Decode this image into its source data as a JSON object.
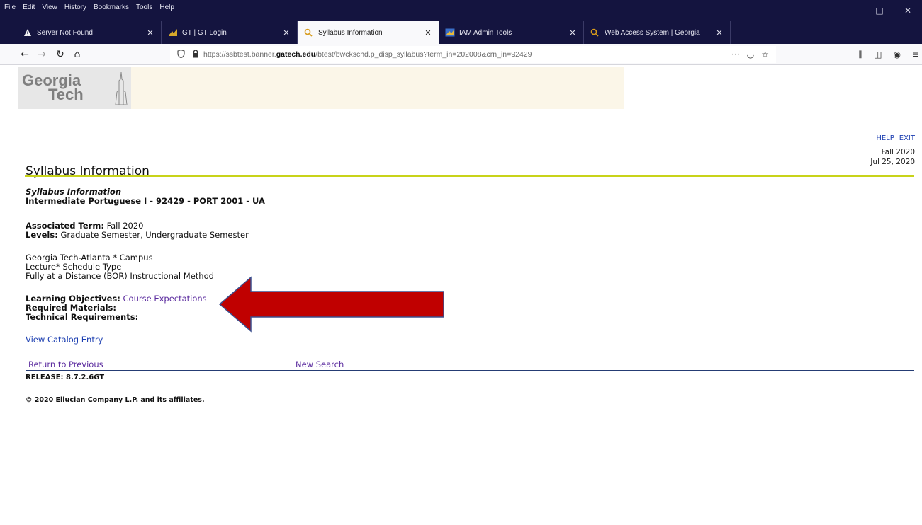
{
  "browser": {
    "menu": [
      "File",
      "Edit",
      "View",
      "History",
      "Bookmarks",
      "Tools",
      "Help"
    ],
    "window_controls": {
      "minimize": "–",
      "maximize": "□",
      "close": "✕"
    },
    "tabs": [
      {
        "title": "Server Not Found",
        "icon": "warning-icon"
      },
      {
        "title": "GT | GT Login",
        "icon": "gt-icon"
      },
      {
        "title": "Syllabus Information",
        "icon": "search-site-icon"
      },
      {
        "title": "IAM Admin Tools",
        "icon": "iam-icon"
      },
      {
        "title": "Web Access System | Georgia",
        "icon": "search-site-icon"
      }
    ],
    "tab_close": "✕",
    "new_tab": "+",
    "url": {
      "prefix": "https://ssbtest.banner.",
      "domain": "gatech.edu",
      "suffix": "/btest/bwckschd.p_disp_syllabus?term_in=202008&crn_in=92429"
    },
    "url_actions": {
      "more": "···",
      "pocket": "◡",
      "bookmark": "☆"
    },
    "nav_icons": {
      "back": "←",
      "forward": "→",
      "reload": "↻",
      "home": "⌂"
    },
    "toolbar_right": {
      "library": "⫼",
      "sidebar": "◫",
      "account": "◉",
      "menu": "≡"
    }
  },
  "page": {
    "logo": {
      "line1": "Georgia",
      "line2": "Tech"
    },
    "util_links": {
      "help": "HELP",
      "exit": "EXIT"
    },
    "term": "Fall 2020",
    "date": "Jul 25, 2020",
    "title": "Syllabus Information",
    "section_title": "Syllabus Information",
    "course_title": "Intermediate Portuguese I - 92429 - PORT 2001 - UA",
    "associated_term_label": "Associated Term:",
    "associated_term_value": " Fall 2020",
    "levels_label": "Levels:",
    "levels_value": " Graduate Semester, Undergraduate Semester",
    "campus": "Georgia Tech-Atlanta * Campus",
    "schedule_type": "Lecture* Schedule Type",
    "instructional_method": "Fully at a Distance (BOR) Instructional Method",
    "learning_objectives_label": "Learning Objectives:",
    "learning_objectives_link": "Course Expectations",
    "required_materials_label": "Required Materials:",
    "technical_requirements_label": "Technical Requirements:",
    "view_catalog": "View Catalog Entry",
    "return_previous": "Return to Previous",
    "new_search": "New Search",
    "release": "RELEASE: 8.7.2.6GT",
    "copyright": "© 2020 Ellucian Company L.P. and its affiliates."
  },
  "annotation": {
    "arrow_color": "#c00000",
    "arrow_outline": "#3b4f8e",
    "direction": "left"
  }
}
